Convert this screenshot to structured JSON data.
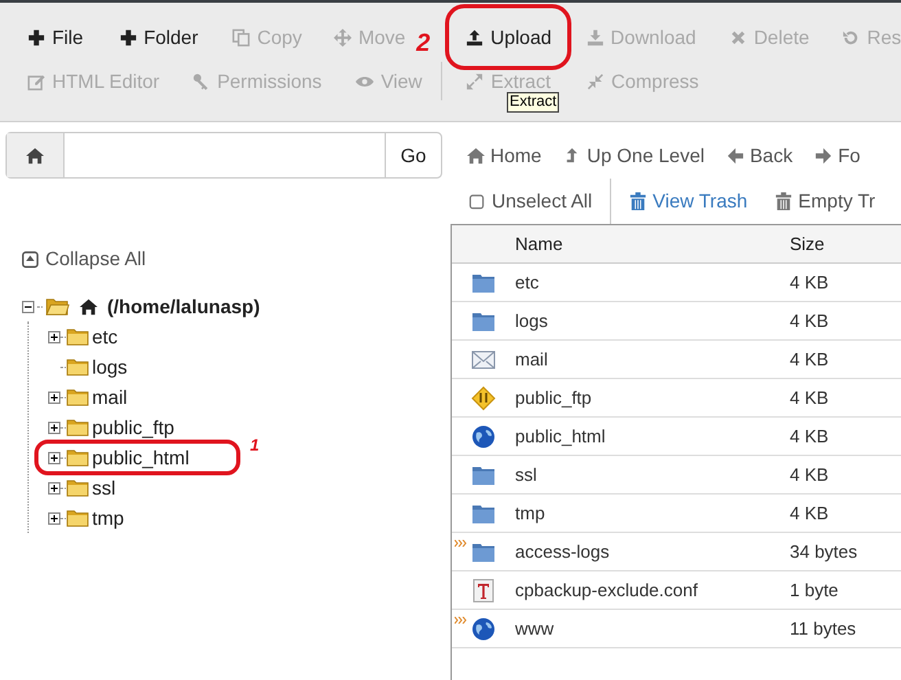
{
  "toolbar_top": [
    {
      "label": "File",
      "disabled": false,
      "circled": false
    },
    {
      "label": "Folder",
      "disabled": false,
      "circled": false
    },
    {
      "label": "Copy",
      "disabled": true,
      "circled": false
    },
    {
      "label": "Move",
      "disabled": true,
      "circled": false
    },
    {
      "label": "Upload",
      "disabled": false,
      "circled": true
    },
    {
      "label": "Download",
      "disabled": true,
      "circled": false
    },
    {
      "label": "Delete",
      "disabled": true,
      "circled": false
    },
    {
      "label": "Res",
      "disabled": true,
      "circled": false
    }
  ],
  "toolbar_bottom": [
    {
      "label": "HTML Editor",
      "disabled": true
    },
    {
      "label": "Permissions",
      "disabled": true
    },
    {
      "label": "View",
      "disabled": true
    },
    {
      "label": "Extract",
      "disabled": true
    },
    {
      "label": "Compress",
      "disabled": true
    }
  ],
  "tooltip": {
    "text": "Extract"
  },
  "step_labels": [
    "2",
    "1"
  ],
  "path_bar": {
    "go": "Go"
  },
  "nav": [
    {
      "label": "Home"
    },
    {
      "label": "Up One Level"
    },
    {
      "label": "Back"
    },
    {
      "label": "Fo"
    }
  ],
  "actions": [
    {
      "label": "Unselect All",
      "link": false
    },
    {
      "label": "View Trash",
      "link": true
    },
    {
      "label": "Empty Tr",
      "link": false
    }
  ],
  "tree": {
    "collapse_all": "Collapse All",
    "root": {
      "label": "(/home/lalunasp)",
      "expanded": true,
      "children": [
        {
          "label": "etc",
          "expandable": true,
          "circled": false
        },
        {
          "label": "logs",
          "expandable": false,
          "circled": false
        },
        {
          "label": "mail",
          "expandable": true,
          "circled": false
        },
        {
          "label": "public_ftp",
          "expandable": true,
          "circled": false
        },
        {
          "label": "public_html",
          "expandable": true,
          "circled": true
        },
        {
          "label": "ssl",
          "expandable": true,
          "circled": false
        },
        {
          "label": "tmp",
          "expandable": true,
          "circled": false
        }
      ]
    }
  },
  "table": {
    "columns": [
      "Name",
      "Size"
    ],
    "rows": [
      {
        "kind": "folder",
        "name": "etc",
        "size": "4 KB",
        "symlink": false
      },
      {
        "kind": "folder",
        "name": "logs",
        "size": "4 KB",
        "symlink": false
      },
      {
        "kind": "mail",
        "name": "mail",
        "size": "4 KB",
        "symlink": false
      },
      {
        "kind": "ftp",
        "name": "public_ftp",
        "size": "4 KB",
        "symlink": false
      },
      {
        "kind": "globe",
        "name": "public_html",
        "size": "4 KB",
        "symlink": false
      },
      {
        "kind": "folder",
        "name": "ssl",
        "size": "4 KB",
        "symlink": false
      },
      {
        "kind": "folder",
        "name": "tmp",
        "size": "4 KB",
        "symlink": false
      },
      {
        "kind": "folder",
        "name": "access-logs",
        "size": "34 bytes",
        "symlink": true
      },
      {
        "kind": "text",
        "name": "cpbackup-exclude.conf",
        "size": "1 byte",
        "symlink": false
      },
      {
        "kind": "globe",
        "name": "www",
        "size": "11 bytes",
        "symlink": true
      }
    ]
  }
}
